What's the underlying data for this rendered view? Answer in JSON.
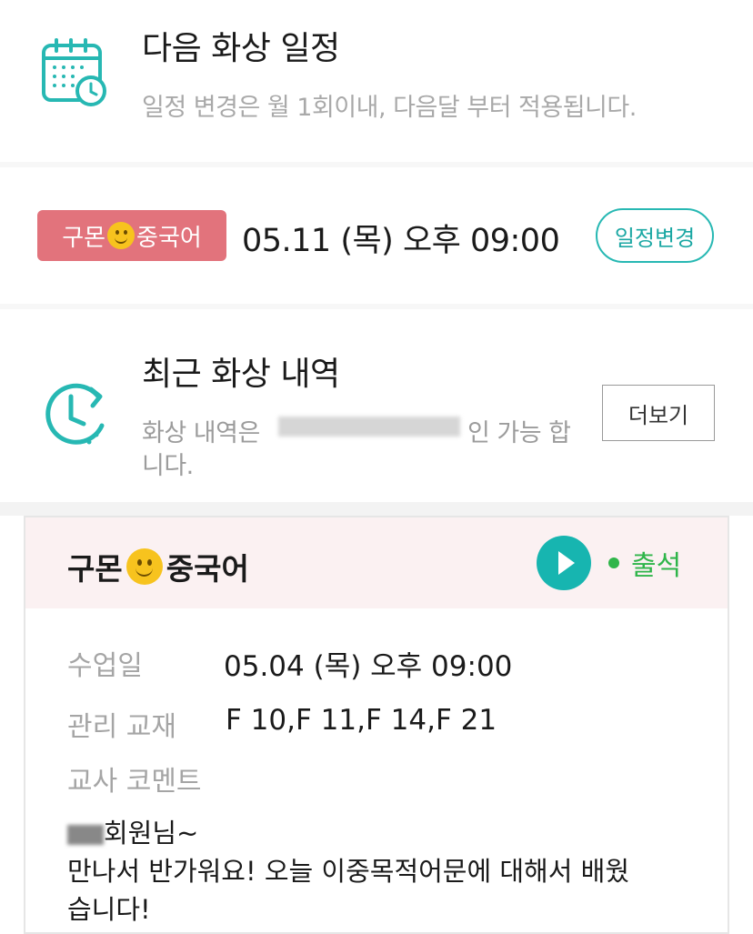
{
  "next_schedule": {
    "title": "다음 화상 일정",
    "subtitle": "일정 변경은 월 1회이내, 다음달 부터 적용됩니다."
  },
  "upcoming": {
    "badge_left": "구몬",
    "badge_right": "중국어",
    "datetime": "05.11 (목) 오후 09:00",
    "change_button": "일정변경"
  },
  "recent": {
    "title": "최근 화상 내역",
    "subtitle_start": "화상 내역은",
    "subtitle_end": "인 가능 합",
    "subtitle_line2": "니다.",
    "more_button": "더보기"
  },
  "card": {
    "title_left": "구몬",
    "title_right": "중국어",
    "status": "출석",
    "class_date_label": "수업일",
    "class_date_value": "05.04 (목) 오후 09:00",
    "material_label": "관리 교재",
    "material_value": "F 10,F 11,F 14,F 21",
    "comment_label": "교사 코멘트",
    "comment_line1": "회원님~",
    "comment_line2": "만나서 반가워요! 오늘 이중목적어문에 대해서 배웠",
    "comment_line3": "습니다!"
  },
  "colors": {
    "teal": "#17b5b0",
    "badge_pink": "#e2737c",
    "attend_green": "#2fb54a",
    "card_header_bg": "#fbf1f2"
  }
}
